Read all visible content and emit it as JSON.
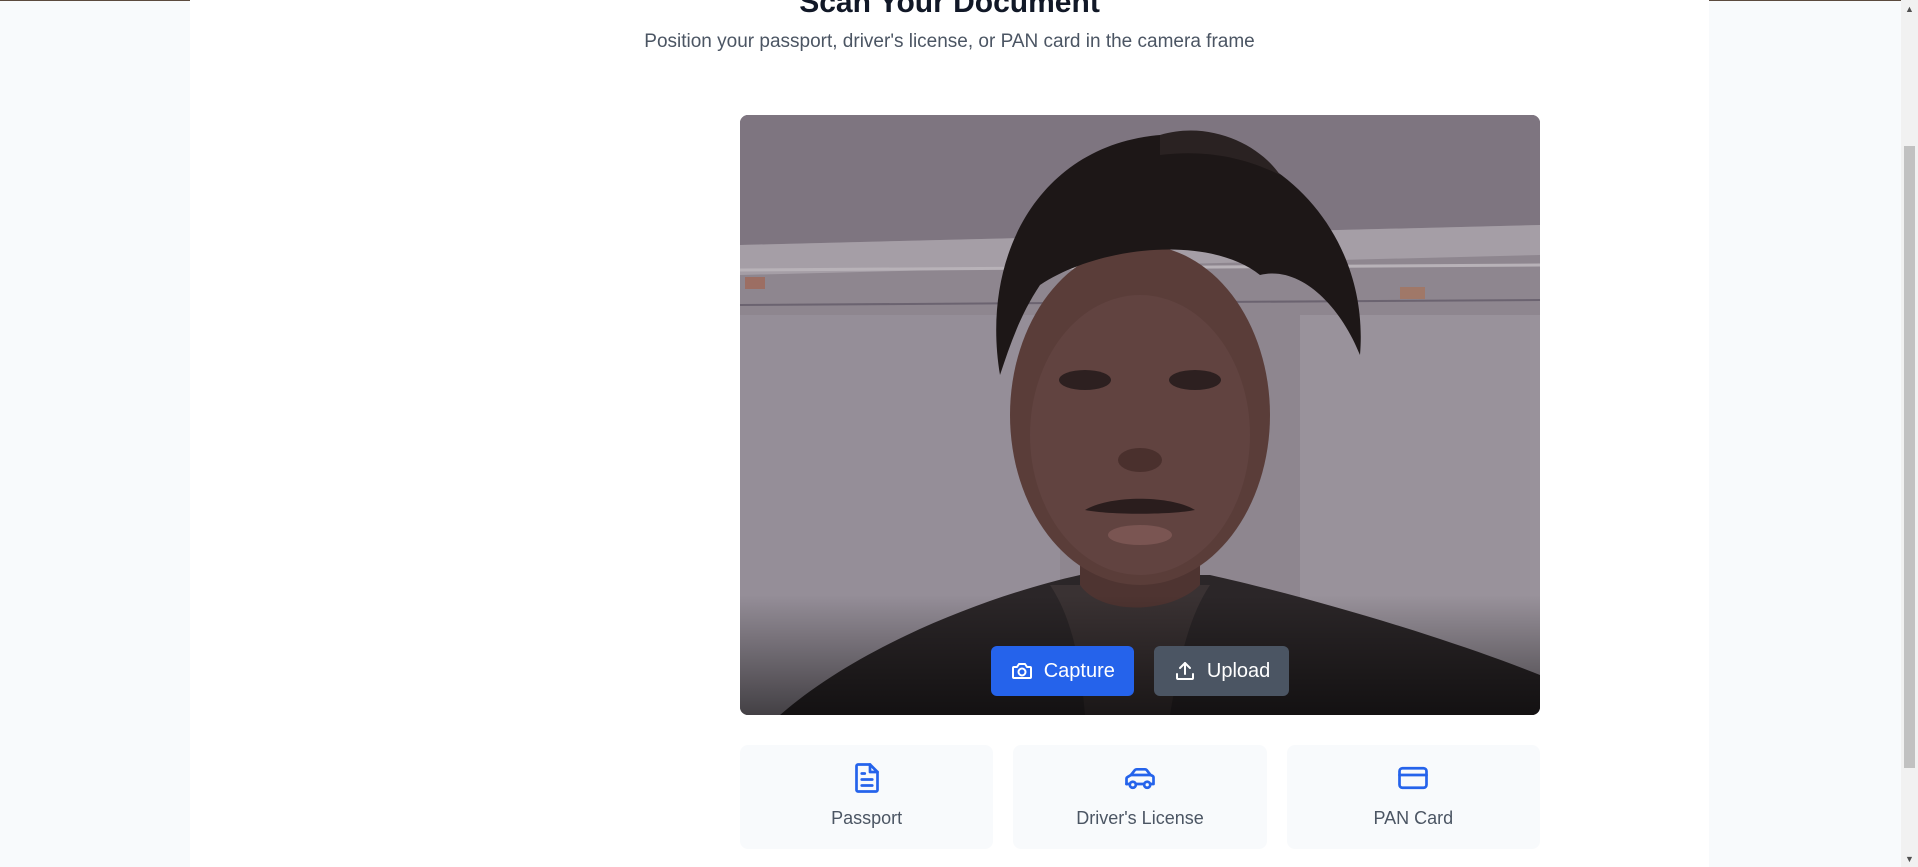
{
  "header": {
    "title": "Scan Your Document",
    "subtitle": "Position your passport, driver's license, or PAN card in the camera frame"
  },
  "camera": {
    "feed_description_icon": "live-camera-feed",
    "actions": {
      "capture_label": "Capture",
      "upload_label": "Upload"
    }
  },
  "document_types": [
    {
      "label": "Passport",
      "icon": "document-icon"
    },
    {
      "label": "Driver's License",
      "icon": "car-icon"
    },
    {
      "label": "PAN Card",
      "icon": "card-icon"
    }
  ],
  "colors": {
    "primary": "#2563eb",
    "secondary": "#4b5563",
    "text_muted": "#4b5563",
    "page_bg": "#f8fafc"
  }
}
